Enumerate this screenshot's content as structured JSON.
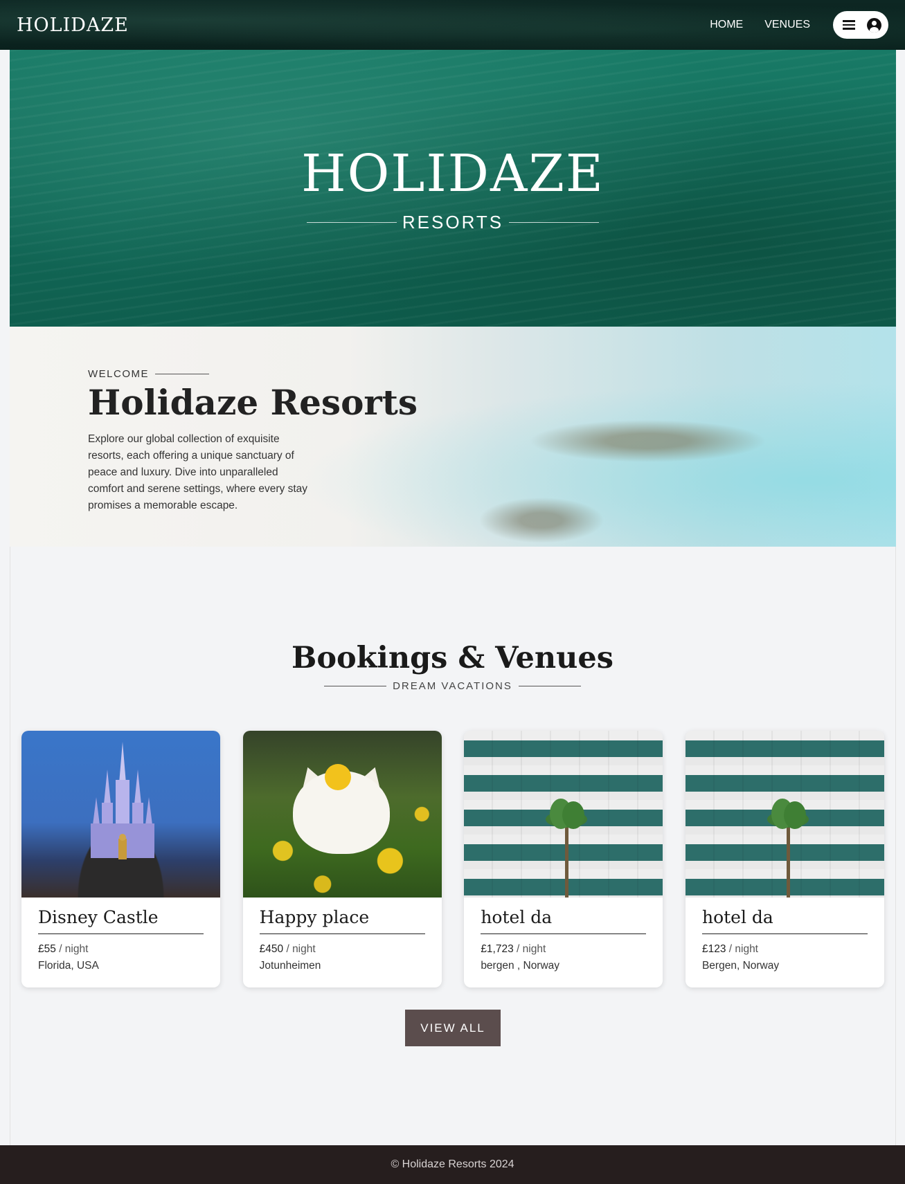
{
  "header": {
    "brand": "HOLIDAZE",
    "nav": [
      {
        "label": "HOME"
      },
      {
        "label": "VENUES"
      }
    ]
  },
  "hero": {
    "title": "HOLIDAZE",
    "subtitle": "RESORTS"
  },
  "welcome": {
    "eyebrow": "WELCOME",
    "title": "Holidaze Resorts",
    "text": "Explore our global collection of exquisite resorts, each offering a unique sanctuary of peace and luxury. Dive into unparalleled comfort and serene settings, where every stay promises a memorable escape."
  },
  "section": {
    "title": "Bookings & Venues",
    "subtitle": "DREAM VACATIONS"
  },
  "venues": [
    {
      "name": "Disney Castle",
      "price": "£55",
      "unit": "/ night",
      "location": "Florida, USA"
    },
    {
      "name": "Happy place",
      "price": "£450",
      "unit": "/ night",
      "location": "Jotunheimen"
    },
    {
      "name": "hotel da",
      "price": "£1,723",
      "unit": "/ night",
      "location": "bergen , Norway"
    },
    {
      "name": "hotel da",
      "price": "£123",
      "unit": "/ night",
      "location": "Bergen, Norway"
    }
  ],
  "view_all_label": "VIEW ALL",
  "footer": {
    "text": "© Holidaze Resorts 2024"
  }
}
